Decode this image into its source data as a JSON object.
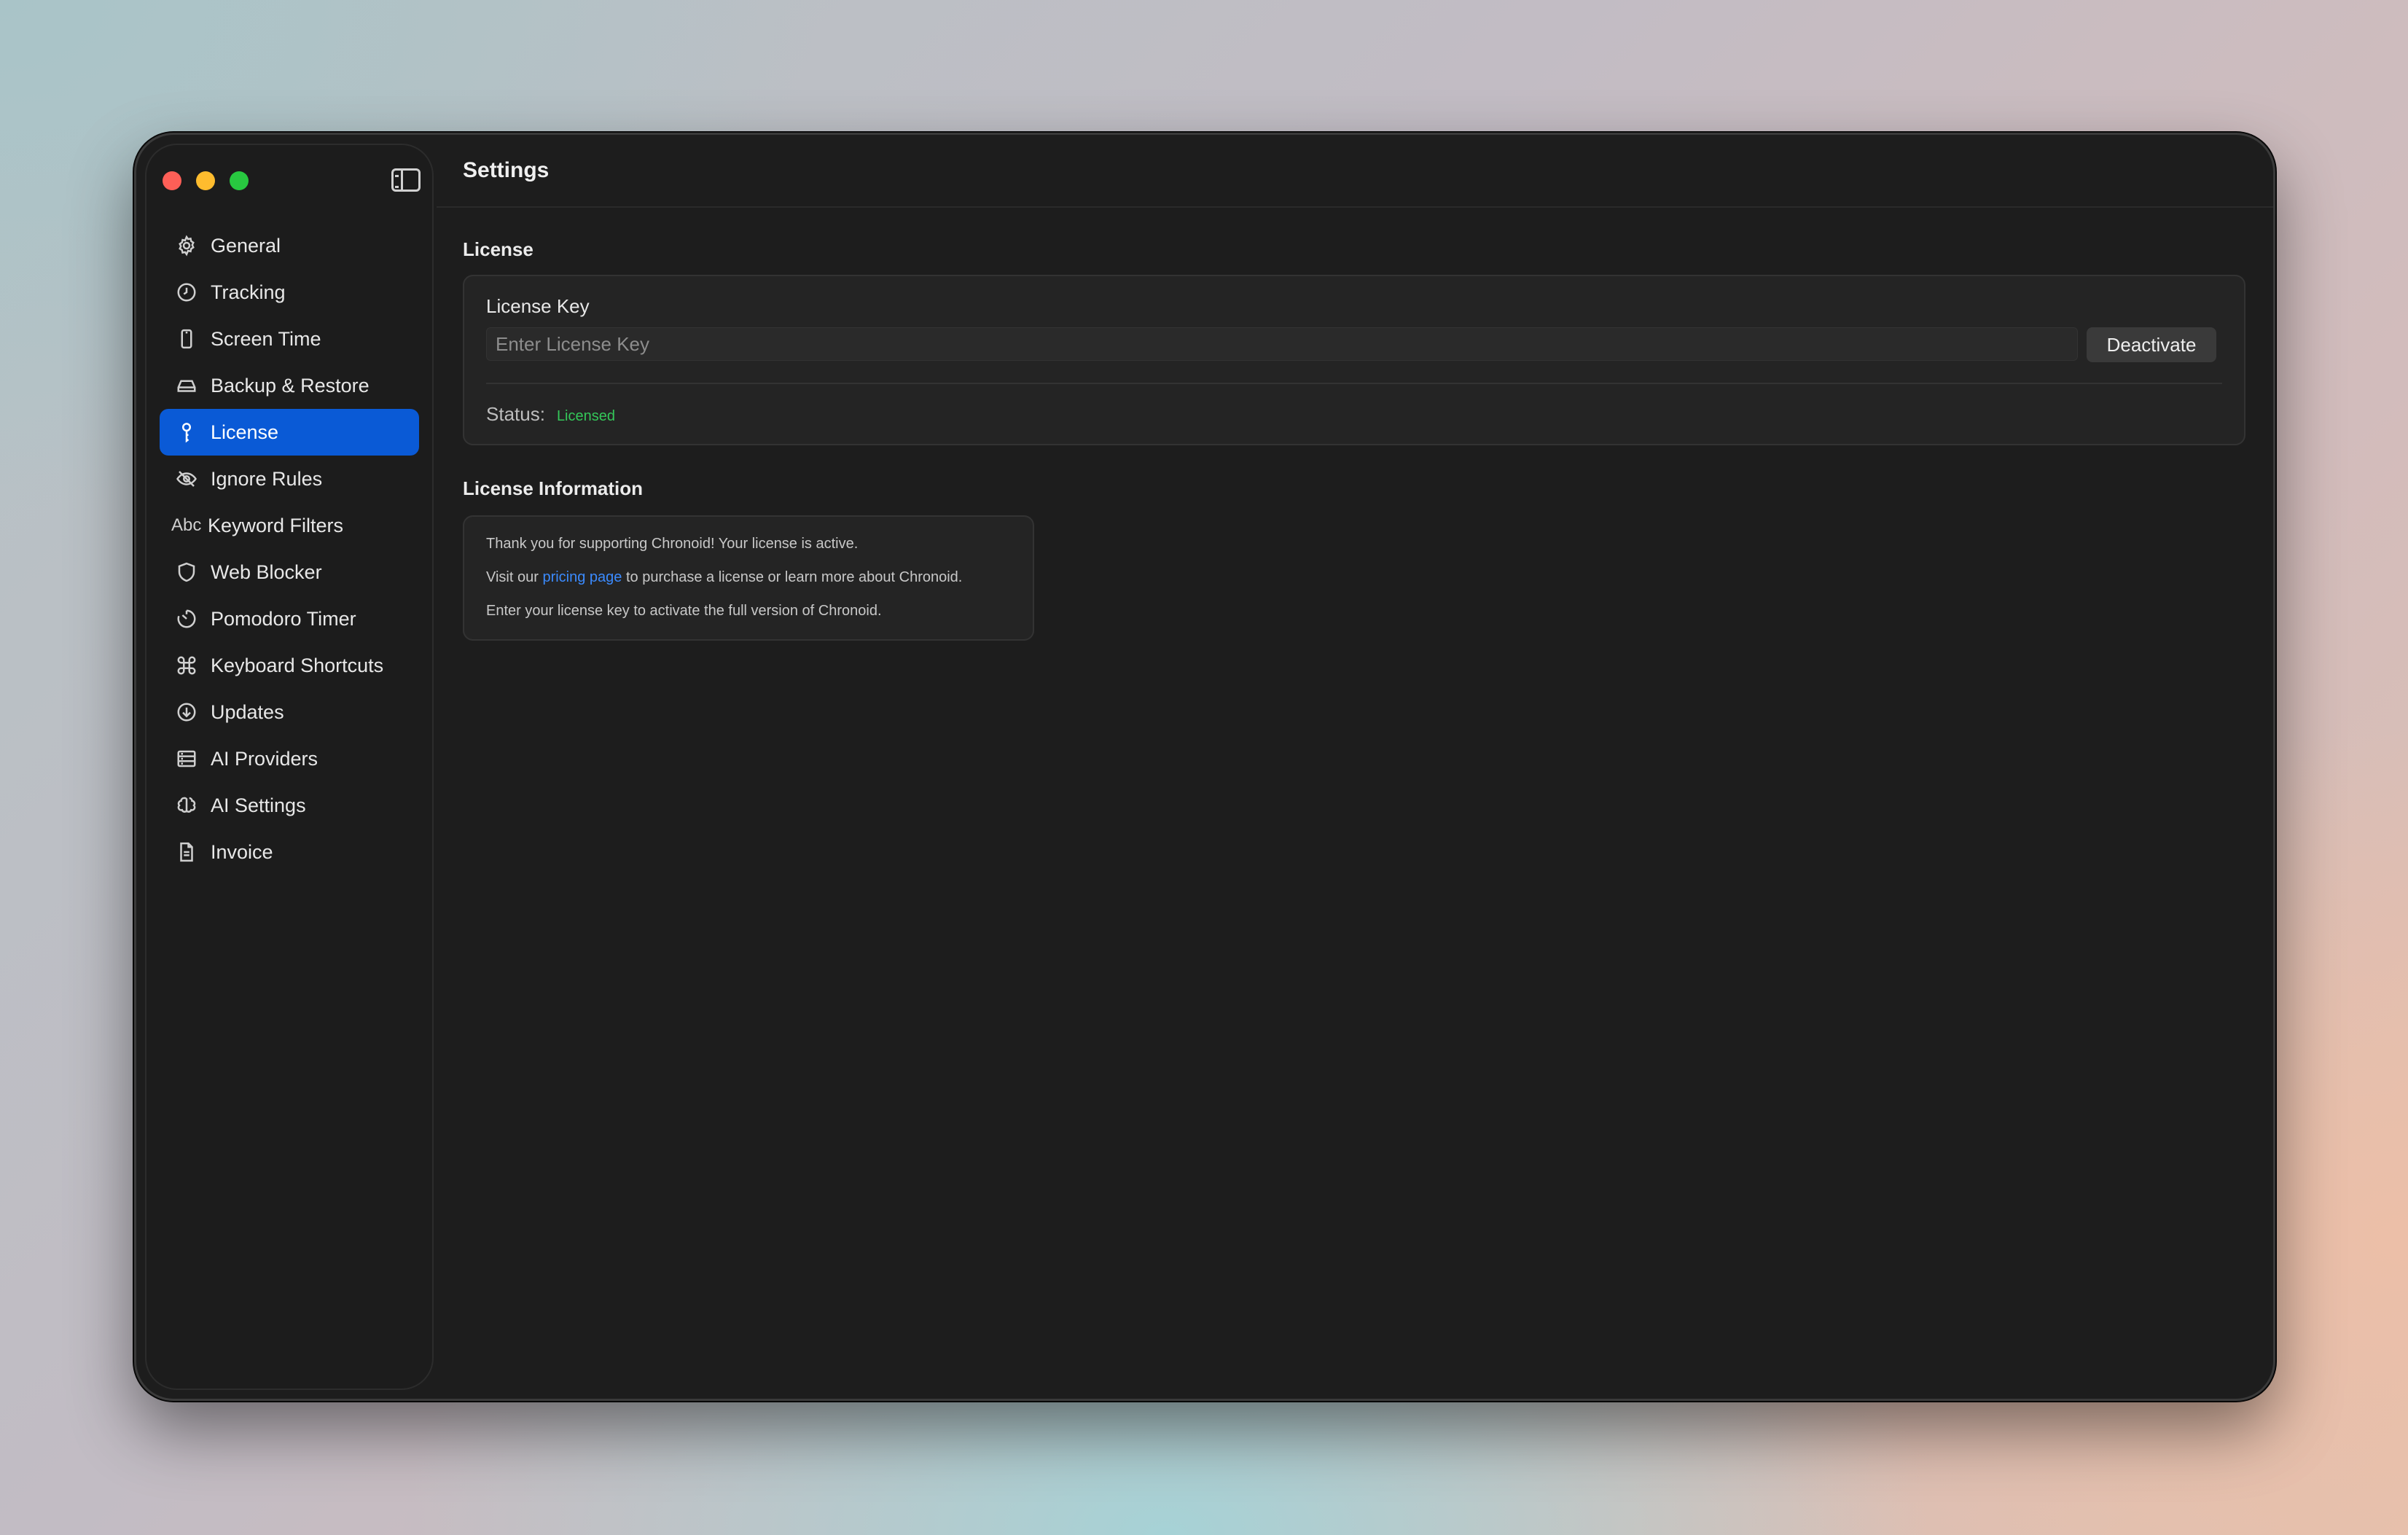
{
  "window": {
    "title": "Settings"
  },
  "sidebar": {
    "items": [
      {
        "label": "General",
        "icon": "gear-icon"
      },
      {
        "label": "Tracking",
        "icon": "clock-icon"
      },
      {
        "label": "Screen Time",
        "icon": "phone-icon"
      },
      {
        "label": "Backup & Restore",
        "icon": "drive-icon"
      },
      {
        "label": "License",
        "icon": "key-icon",
        "active": true
      },
      {
        "label": "Ignore Rules",
        "icon": "eye-slash-icon"
      },
      {
        "label": "Keyword Filters",
        "icon": "abc-icon",
        "icon_text": "Abc"
      },
      {
        "label": "Web Blocker",
        "icon": "shield-icon"
      },
      {
        "label": "Pomodoro Timer",
        "icon": "timer-icon"
      },
      {
        "label": "Keyboard Shortcuts",
        "icon": "command-icon"
      },
      {
        "label": "Updates",
        "icon": "download-icon"
      },
      {
        "label": "AI Providers",
        "icon": "server-icon"
      },
      {
        "label": "AI Settings",
        "icon": "brain-icon"
      },
      {
        "label": "Invoice",
        "icon": "document-icon"
      }
    ]
  },
  "license": {
    "section_title": "License",
    "key_label": "License Key",
    "key_value": "",
    "key_placeholder": "Enter License Key",
    "deactivate_label": "Deactivate",
    "status_label": "Status:",
    "status_value": "Licensed"
  },
  "info": {
    "section_title": "License Information",
    "line1": "Thank you for supporting Chronoid! Your license is active.",
    "line2_prefix": "Visit our",
    "line2_link": "pricing page",
    "line2_suffix": "to purchase a license or learn more about Chronoid.",
    "line3": "Enter your license key to activate the full version of Chronoid."
  },
  "colors": {
    "accent": "#0a5ad6",
    "status_ok": "#34c759",
    "link": "#3b8bff"
  }
}
